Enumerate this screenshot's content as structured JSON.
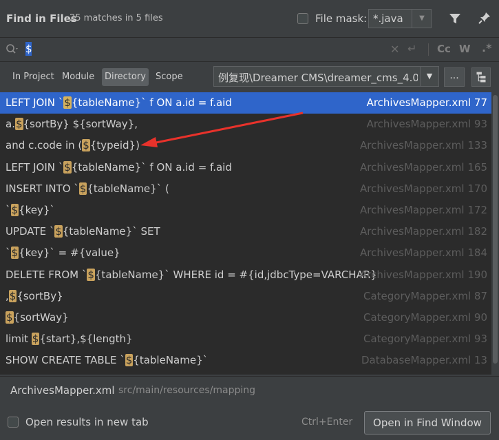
{
  "header": {
    "title": "Find in Files",
    "matches": "25 matches in 5 files",
    "file_mask_label": "File mask:",
    "file_mask_value": "*.java"
  },
  "search": {
    "query": "$",
    "cc_label": "Cc",
    "words_label": "W",
    "regex_label": ".*"
  },
  "scope": {
    "tabs": [
      "In Project",
      "Module",
      "Directory",
      "Scope"
    ],
    "active_tab": "Directory",
    "directory_value": "例复现\\Dreamer CMS\\dreamer_cms_4.0",
    "browse_label": "..."
  },
  "results": [
    {
      "pre": "LEFT JOIN `",
      "match": "$",
      "post": "{tableName}` f ON a.id = f.aid",
      "loc": "ArchivesMapper.xml 77",
      "selected": true
    },
    {
      "pre": "a.",
      "match": "$",
      "post": "{sortBy} ${sortWay},",
      "loc": "ArchivesMapper.xml 93"
    },
    {
      "pre": "and c.code in (",
      "match": "$",
      "post": "{typeid})",
      "loc": "ArchivesMapper.xml 133"
    },
    {
      "pre": "LEFT JOIN `",
      "match": "$",
      "post": "{tableName}` f ON a.id = f.aid",
      "loc": "ArchivesMapper.xml 165"
    },
    {
      "pre": "INSERT INTO `",
      "match": "$",
      "post": "{tableName}` (",
      "loc": "ArchivesMapper.xml 170"
    },
    {
      "pre": "`",
      "match": "$",
      "post": "{key}`",
      "loc": "ArchivesMapper.xml 172"
    },
    {
      "pre": "UPDATE `",
      "match": "$",
      "post": "{tableName}` SET",
      "loc": "ArchivesMapper.xml 182"
    },
    {
      "pre": "`",
      "match": "$",
      "post": "{key}` = #{value}",
      "loc": "ArchivesMapper.xml 184"
    },
    {
      "pre": "DELETE FROM `",
      "match": "$",
      "post": "{tableName}` WHERE id = #{id,jdbcType=VARCHAR}",
      "loc": "ArchivesMapper.xml 190"
    },
    {
      "pre": ",",
      "match": "$",
      "post": "{sortBy}",
      "loc": "CategoryMapper.xml 87"
    },
    {
      "pre": "",
      "match": "$",
      "post": "{sortWay}",
      "loc": "CategoryMapper.xml 90"
    },
    {
      "pre": "limit ",
      "match": "$",
      "post": "{start},${length}",
      "loc": "CategoryMapper.xml 93"
    },
    {
      "pre": "SHOW CREATE TABLE `",
      "match": "$",
      "post": "{tableName}`",
      "loc": "DatabaseMapper.xml 13"
    }
  ],
  "preview": {
    "file": "ArchivesMapper.xml",
    "path": "src/main/resources/mapping"
  },
  "footer": {
    "new_tab_label": "Open results in new tab",
    "shortcut": "Ctrl+Enter",
    "open_button": "Open in Find Window"
  },
  "colors": {
    "background": "#3c3f41",
    "results_bg": "#2b2b2b",
    "selection": "#2f65ca",
    "match_highlight": "#c9a25d",
    "annotation_arrow": "#e8322b"
  }
}
